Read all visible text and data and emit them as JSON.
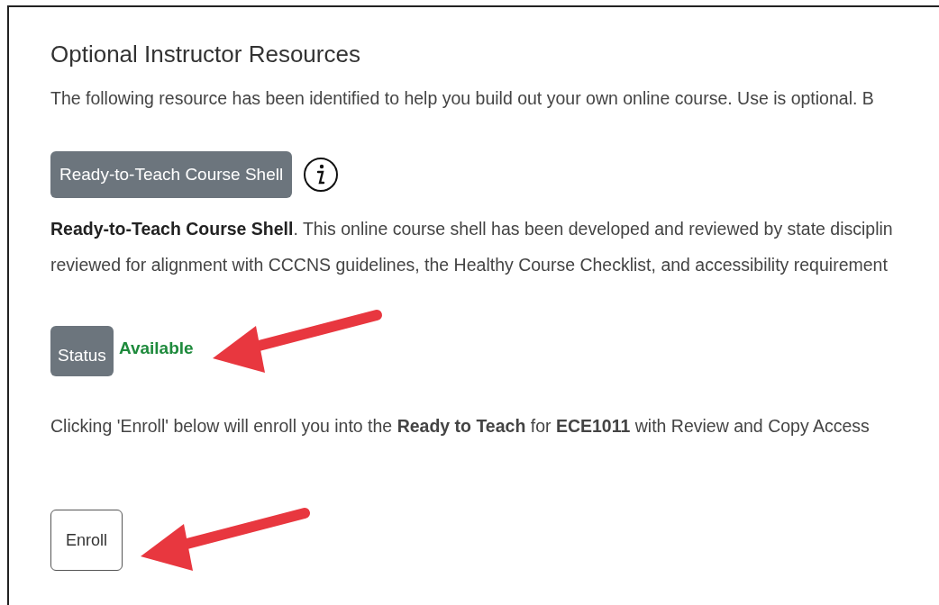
{
  "section": {
    "title": "Optional Instructor Resources",
    "intro": "The following resource has been identified to help you build out your own online course. Use is optional. B"
  },
  "resource": {
    "button": "Ready-to-Teach Course Shell",
    "description_lines": [
      "**Ready-to-Teach Course Shell**. This online course shell has been developed and reviewed by state disciplin",
      "reviewed for alignment with CCCNS guidelines, the Healthy Course Checklist, and accessibility requirement"
    ]
  },
  "status": {
    "label": "Status",
    "value": "Available"
  },
  "enroll_note": "Clicking 'Enroll' below will enroll you into the **Ready to Teach** for **ECE1011** with Review and Copy Access",
  "enroll_button": "Enroll"
}
